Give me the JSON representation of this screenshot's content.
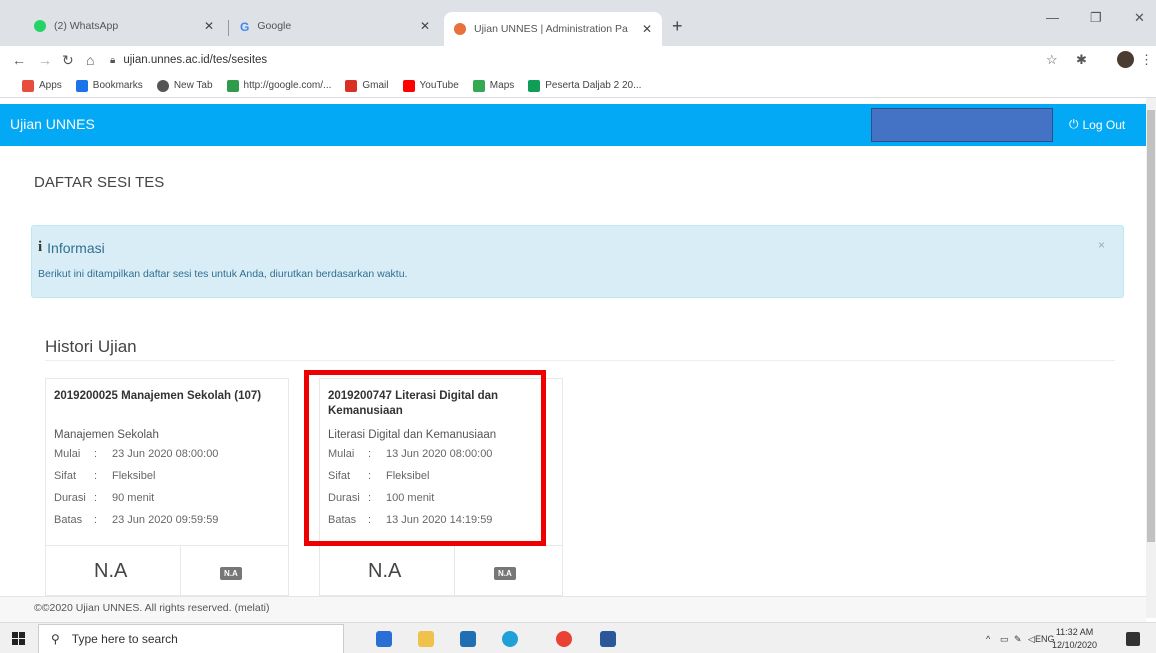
{
  "browser": {
    "tabs": [
      {
        "label": "(2) WhatsApp",
        "icon": "whatsapp-icon",
        "color": "#25d366"
      },
      {
        "label": "Google",
        "icon": "google-icon",
        "color": "#4285f4"
      },
      {
        "label": "Ujian UNNES | Administration Pa",
        "icon": "browser-icon",
        "color": "#e8703a"
      }
    ],
    "new_tab": "+",
    "url": "ujian.unnes.ac.id/tes/sesites",
    "bookmarks": [
      {
        "label": "Apps",
        "color": "#e74c3c"
      },
      {
        "label": "Bookmarks",
        "color": "#1a73e8"
      },
      {
        "label": "New Tab",
        "color": "#555555"
      },
      {
        "label": "http://google.com/...",
        "color": "#2e9c4a"
      },
      {
        "label": "Gmail",
        "color": "#d93025"
      },
      {
        "label": "YouTube",
        "color": "#ff0000"
      },
      {
        "label": "Maps",
        "color": "#34a853"
      },
      {
        "label": "Peserta Daljab 2 20...",
        "color": "#0f9d58"
      }
    ]
  },
  "header": {
    "brand": "Ujian UNNES",
    "logout": "Log Out"
  },
  "page": {
    "title": "DAFTAR SESI TES",
    "alert": {
      "heading": "Informasi",
      "message": "Berikut ini ditampilkan daftar sesi tes untuk Anda, diurutkan berdasarkan waktu.",
      "close": "×"
    },
    "section_title": "Histori Ujian",
    "cards": [
      {
        "title": "2019200025 Manajemen Sekolah (107)",
        "subtitle": "Manajemen Sekolah",
        "rows": [
          {
            "key": "Mulai",
            "value": "23 Jun 2020 08:00:00"
          },
          {
            "key": "Sifat",
            "value": "Fleksibel"
          },
          {
            "key": "Durasi",
            "value": "90 menit"
          },
          {
            "key": "Batas",
            "value": "23 Jun 2020 09:59:59"
          }
        ],
        "score": "N.A",
        "badge": "N.A"
      },
      {
        "title": "2019200747 Literasi Digital dan Kemanusiaan",
        "subtitle": "Literasi Digital dan Kemanusiaan",
        "rows": [
          {
            "key": "Mulai",
            "value": "13 Jun 2020 08:00:00"
          },
          {
            "key": "Sifat",
            "value": "Fleksibel"
          },
          {
            "key": "Durasi",
            "value": "100 menit"
          },
          {
            "key": "Batas",
            "value": "13 Jun 2020 14:19:59"
          }
        ],
        "score": "N.A",
        "badge": "N.A"
      }
    ],
    "footer": "©©2020 Ujian UNNES. All rights reserved. (melati)"
  },
  "taskbar": {
    "search_placeholder": "Type here to search",
    "lang": "ENG",
    "time": "11:32 AM",
    "date": "12/10/2020"
  },
  "colors": {
    "header_bg": "#03a9f4",
    "alert_bg": "#d9edf7",
    "highlight": "#ee0000"
  }
}
